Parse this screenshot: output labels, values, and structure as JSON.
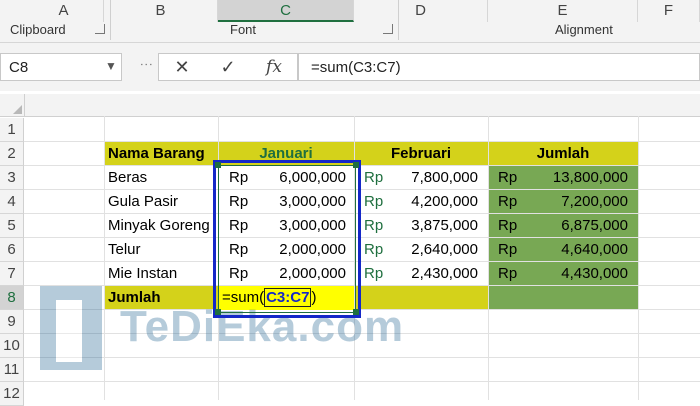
{
  "ribbon": {
    "groups": [
      "Clipboard",
      "Font",
      "Alignment"
    ]
  },
  "formula_bar": {
    "name_box": "C8",
    "cancel_icon": "✕",
    "enter_icon": "✓",
    "fx_label": "fx",
    "formula": "=sum(C3:C7)"
  },
  "columns": [
    "A",
    "B",
    "C",
    "D",
    "E",
    "F"
  ],
  "rows": [
    "1",
    "2",
    "3",
    "4",
    "5",
    "6",
    "7",
    "8",
    "9",
    "10",
    "11",
    "12"
  ],
  "table": {
    "headers": {
      "b": "Nama Barang",
      "c": "Januari",
      "d": "Februari",
      "e": "Jumlah"
    },
    "items": [
      {
        "name": "Beras",
        "jan": "6,000,000",
        "feb": "7,800,000",
        "total": "13,800,000"
      },
      {
        "name": "Gula Pasir",
        "jan": "3,000,000",
        "feb": "4,200,000",
        "total": "7,200,000"
      },
      {
        "name": "Minyak Goreng",
        "jan": "3,000,000",
        "feb": "3,875,000",
        "total": "6,875,000"
      },
      {
        "name": "Telur",
        "jan": "2,000,000",
        "feb": "2,640,000",
        "total": "4,640,000"
      },
      {
        "name": "Mie Instan",
        "jan": "2,000,000",
        "feb": "2,430,000",
        "total": "4,430,000"
      }
    ],
    "currency": "Rp",
    "total_label": "Jumlah",
    "edit": {
      "prefix": "=sum(",
      "ref": "C3:C7",
      "suffix": ")"
    }
  },
  "watermark": {
    "text": "TeDiEka.com"
  },
  "colors": {
    "header_fill": "#d4d21a",
    "green_fill": "#78a854",
    "yellow_fill": "#ffff00",
    "selection_border": "#1428c8"
  }
}
